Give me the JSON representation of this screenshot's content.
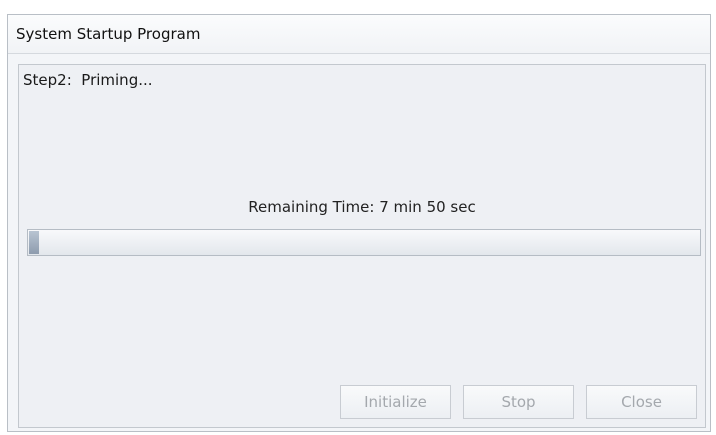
{
  "window": {
    "title": "System Startup Program"
  },
  "content": {
    "step_label": "Step2:  Priming...",
    "remaining_time": "Remaining Time: 7 min 50 sec",
    "progress_fraction": 0.015
  },
  "buttons": {
    "initialize": "Initialize",
    "stop": "Stop",
    "close": "Close"
  },
  "colors": {
    "disabled_text": "#a4a8ad",
    "progress_fill": "#9aa8b8"
  }
}
